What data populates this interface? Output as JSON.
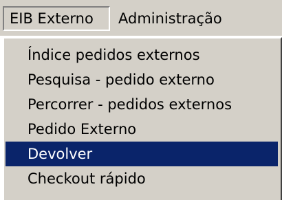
{
  "menubar": {
    "items": [
      {
        "label": "EIB Externo",
        "active": true
      },
      {
        "label": "Administração",
        "active": false
      }
    ]
  },
  "dropdown": {
    "items": [
      {
        "label": "Índice pedidos externos",
        "selected": false
      },
      {
        "label": "Pesquisa - pedido externo",
        "selected": false
      },
      {
        "label": "Percorrer - pedidos externos",
        "selected": false
      },
      {
        "label": "Pedido Externo",
        "selected": false
      },
      {
        "label": "Devolver",
        "selected": true
      },
      {
        "label": "Checkout rápido",
        "selected": false
      }
    ]
  },
  "colors": {
    "face": "#d4d0c8",
    "highlight": "#0a246a",
    "highlight_text": "#ffffff"
  }
}
